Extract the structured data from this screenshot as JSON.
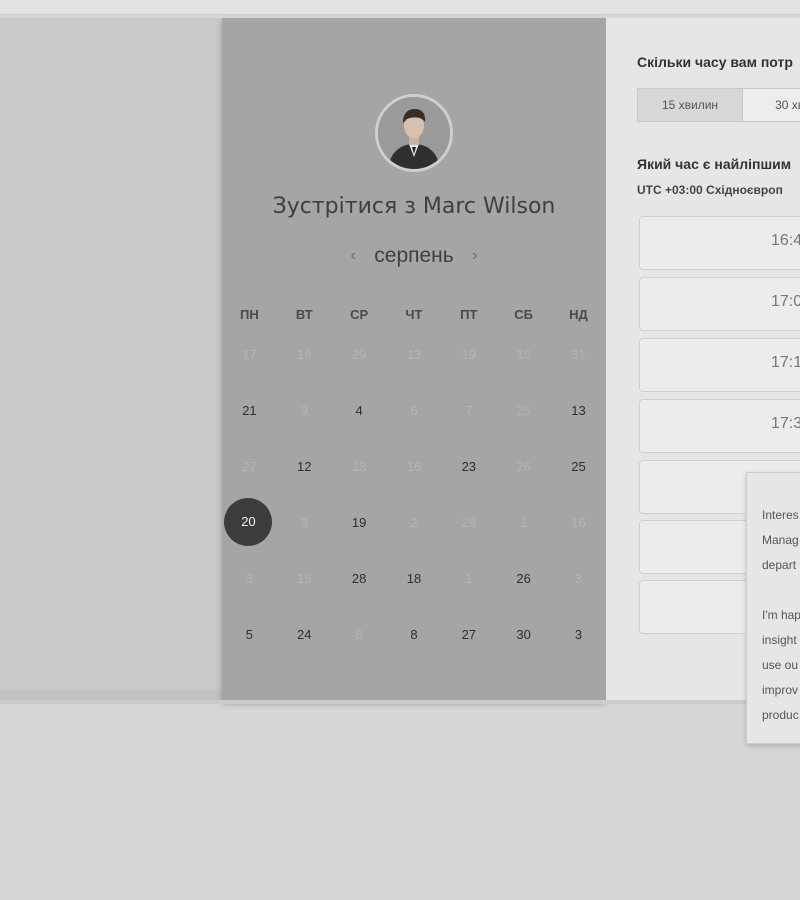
{
  "profile": {
    "title": "Зустрітися з Marc Wilson",
    "avatar_icon": "person-photo"
  },
  "calendar": {
    "month": "серпень",
    "prev_icon": "chevron-left-icon",
    "next_icon": "chevron-right-icon",
    "weekdays": [
      "ПН",
      "ВТ",
      "СР",
      "ЧТ",
      "ПТ",
      "СБ",
      "НД"
    ],
    "weeks": [
      [
        {
          "d": "17",
          "a": false
        },
        {
          "d": "19",
          "a": false
        },
        {
          "d": "29",
          "a": false
        },
        {
          "d": "13",
          "a": false
        },
        {
          "d": "19",
          "a": false
        },
        {
          "d": "10",
          "a": false
        },
        {
          "d": "31",
          "a": false
        }
      ],
      [
        {
          "d": "21",
          "a": true
        },
        {
          "d": "9",
          "a": false
        },
        {
          "d": "4",
          "a": true
        },
        {
          "d": "6",
          "a": false
        },
        {
          "d": "7",
          "a": false
        },
        {
          "d": "25",
          "a": false
        },
        {
          "d": "13",
          "a": true
        }
      ],
      [
        {
          "d": "27",
          "a": false
        },
        {
          "d": "12",
          "a": true
        },
        {
          "d": "13",
          "a": false
        },
        {
          "d": "16",
          "a": false
        },
        {
          "d": "23",
          "a": true
        },
        {
          "d": "26",
          "a": false
        },
        {
          "d": "25",
          "a": true
        }
      ],
      [
        {
          "d": "20",
          "a": true,
          "s": true
        },
        {
          "d": "3",
          "a": false
        },
        {
          "d": "19",
          "a": true
        },
        {
          "d": "2",
          "a": false
        },
        {
          "d": "28",
          "a": false
        },
        {
          "d": "1",
          "a": false
        },
        {
          "d": "16",
          "a": false
        }
      ],
      [
        {
          "d": "3",
          "a": false
        },
        {
          "d": "15",
          "a": false
        },
        {
          "d": "28",
          "a": true
        },
        {
          "d": "18",
          "a": true
        },
        {
          "d": "1",
          "a": false
        },
        {
          "d": "26",
          "a": true
        },
        {
          "d": "3",
          "a": false
        }
      ],
      [
        {
          "d": "5",
          "a": true
        },
        {
          "d": "24",
          "a": true
        },
        {
          "d": "8",
          "a": false
        },
        {
          "d": "8",
          "a": true
        },
        {
          "d": "27",
          "a": true
        },
        {
          "d": "30",
          "a": true
        },
        {
          "d": "3",
          "a": true
        }
      ]
    ],
    "selected_color": "#3d3d3d"
  },
  "booking": {
    "duration_question": "Скільки часу вам потр",
    "durations": [
      "15 хвилин",
      "30 хви"
    ],
    "time_question": "Який час є найліпшим",
    "timezone": "UTC +03:00 Східноєвроп",
    "slots": [
      "16:4",
      "17:0",
      "17:1",
      "17:3",
      "",
      "",
      ""
    ]
  },
  "popup": {
    "lines": [
      "Interes",
      "Manag",
      "depart",
      "",
      "I'm hap",
      "insight",
      "use ou",
      "improv",
      "produc"
    ]
  }
}
